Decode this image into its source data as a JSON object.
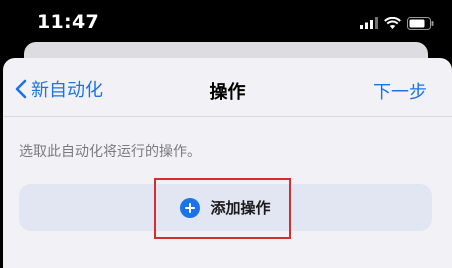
{
  "status_bar": {
    "time": "11:47",
    "icons": [
      "signal-icon",
      "wifi-icon",
      "battery-icon"
    ]
  },
  "nav": {
    "back_label": "新自动化",
    "title": "操作",
    "next_label": "下一步"
  },
  "content": {
    "description": "选取此自动化将运行的操作。",
    "add_action_label": "添加操作"
  },
  "colors": {
    "accent": "#1a73e8",
    "sheet_background": "#f2f2f6",
    "add_row_background": "#e2e6f3",
    "highlight": "#d32f2f"
  }
}
